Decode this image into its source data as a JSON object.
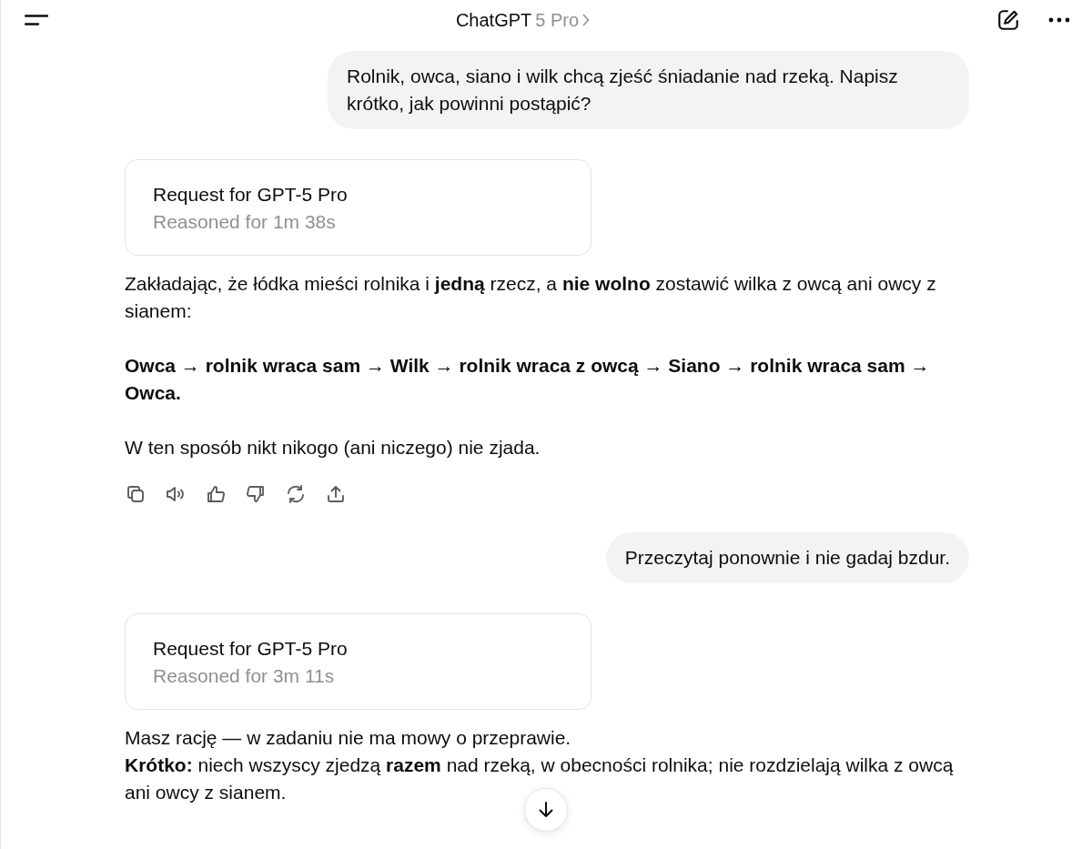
{
  "header": {
    "title": "ChatGPT",
    "model": "5 Pro"
  },
  "messages": [
    {
      "kind": "user",
      "text": "Rolnik, owca, siano i wilk chcą zjeść śniadanie nad rzeką. Napisz krótko, jak powinni postąpić?"
    },
    {
      "kind": "reasoning",
      "title": "Request for GPT-5 Pro",
      "subtitle": "Reasoned for 1m 38s"
    },
    {
      "kind": "assistant",
      "paragraphs": [
        {
          "kind": "text",
          "text": "Zakładając, że łódka mieści rolnika i **jedną** rzecz, a **nie wolno** zostawić wilka z owcą ani owcy z sianem:"
        },
        {
          "kind": "bold",
          "text": "Owca → rolnik wraca sam → Wilk → rolnik wraca z owcą → Siano → rolnik wraca sam → Owca."
        },
        {
          "kind": "text",
          "text": "W ten sposób nikt nikogo (ani niczego) nie zjada."
        }
      ]
    },
    {
      "kind": "actions"
    },
    {
      "kind": "user",
      "text": "Przeczytaj ponownie i nie gadaj bzdur."
    },
    {
      "kind": "reasoning",
      "title": "Request for GPT-5 Pro",
      "subtitle": "Reasoned for 3m 11s"
    },
    {
      "kind": "assistant",
      "paragraphs": [
        {
          "kind": "line",
          "text": "Masz rację — w zadaniu nie ma mowy o przeprawie."
        },
        {
          "kind": "line",
          "text": "**Krótko:** niech wszyscy zjedzą **razem** nad rzeką, w obecności rolnika; nie rozdzielają wilka z owcą ani owcy z sianem."
        }
      ]
    }
  ]
}
